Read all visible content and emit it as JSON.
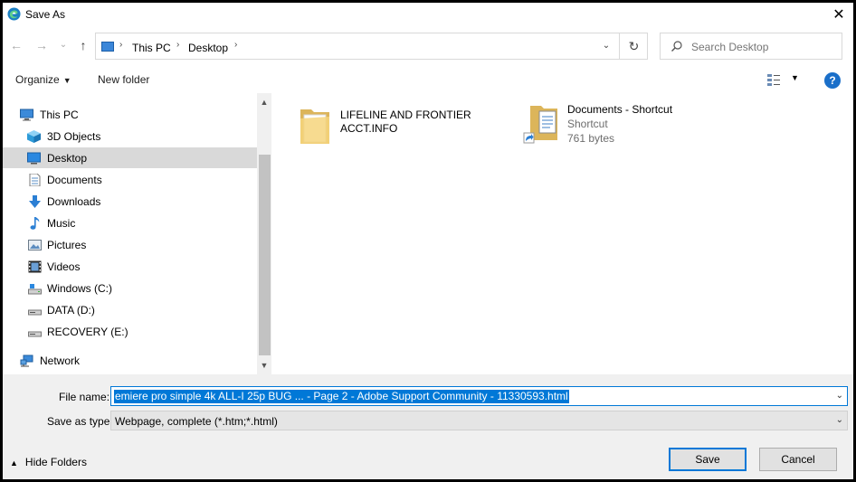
{
  "window": {
    "title": "Save As",
    "close_label": "✕"
  },
  "nav": {
    "back_icon": "←",
    "forward_icon": "→",
    "recent_icon": "⌄",
    "up_icon": "↑",
    "breadcrumb": [
      "This PC",
      "Desktop"
    ],
    "crumb_separator": "›",
    "address_dropdown_icon": "⌄",
    "refresh_icon": "↻",
    "search_placeholder": "Search Desktop"
  },
  "toolbar": {
    "organize_label": "Organize",
    "new_folder_label": "New folder",
    "help_label": "?"
  },
  "navigation_pane": {
    "items": [
      {
        "label": "This PC",
        "icon": "pc-icon"
      },
      {
        "label": "3D Objects",
        "icon": "cube-icon"
      },
      {
        "label": "Desktop",
        "icon": "desktop-icon",
        "selected": true
      },
      {
        "label": "Documents",
        "icon": "document-icon"
      },
      {
        "label": "Downloads",
        "icon": "download-icon"
      },
      {
        "label": "Music",
        "icon": "music-icon"
      },
      {
        "label": "Pictures",
        "icon": "picture-icon"
      },
      {
        "label": "Videos",
        "icon": "video-icon"
      },
      {
        "label": "Windows (C:)",
        "icon": "drive-icon"
      },
      {
        "label": "DATA (D:)",
        "icon": "drive-icon"
      },
      {
        "label": "RECOVERY (E:)",
        "icon": "drive-icon"
      },
      {
        "label": "Network",
        "icon": "network-icon"
      }
    ]
  },
  "files": [
    {
      "name_line1": "LIFELINE AND FRONTIER",
      "name_line2": "ACCT.INFO",
      "icon": "folder-icon"
    },
    {
      "name": "Documents - Shortcut",
      "type": "Shortcut",
      "size": "761 bytes",
      "icon": "shortcut-icon"
    }
  ],
  "footer": {
    "file_name_label": "File name:",
    "file_name_value": "emiere pro simple 4k ALL-I 25p BUG ... - Page 2 - Adobe Support Community - 11330593.html",
    "save_type_label": "Save as type:",
    "save_type_value": "Webpage, complete (*.htm;*.html)",
    "hide_folders_label": "Hide Folders",
    "save_label": "Save",
    "cancel_label": "Cancel"
  },
  "colors": {
    "accent": "#0078d7",
    "selection": "#d9d9d9",
    "footer_bg": "#f0f0f0"
  }
}
